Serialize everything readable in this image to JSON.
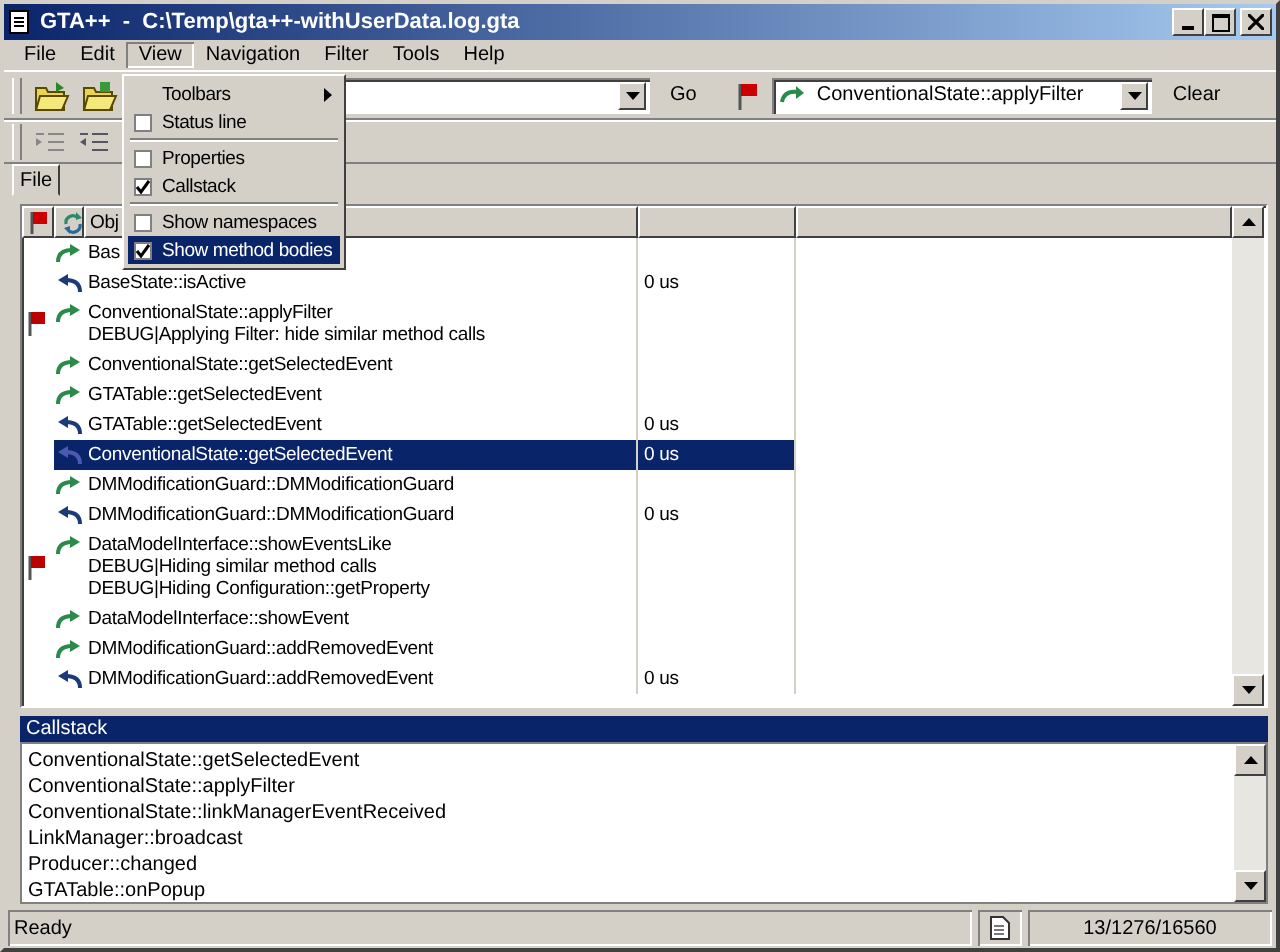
{
  "window": {
    "title": "GTA++  -  C:\\Temp\\gta++-withUserData.log.gta"
  },
  "menu_bar": [
    {
      "label": "File",
      "selected": false
    },
    {
      "label": "Edit",
      "selected": false
    },
    {
      "label": "View",
      "selected": true
    },
    {
      "label": "Navigation",
      "selected": false
    },
    {
      "label": "Filter",
      "selected": false
    },
    {
      "label": "Tools",
      "selected": false
    },
    {
      "label": "Help",
      "selected": false
    }
  ],
  "view_menu": [
    {
      "kind": "submenu",
      "label": "Toolbars",
      "selected": false
    },
    {
      "kind": "check",
      "label": "Status line",
      "checked": false,
      "selected": false
    },
    {
      "kind": "separator"
    },
    {
      "kind": "check",
      "label": "Properties",
      "checked": false,
      "selected": false
    },
    {
      "kind": "check",
      "label": "Callstack",
      "checked": true,
      "selected": false
    },
    {
      "kind": "separator"
    },
    {
      "kind": "check",
      "label": "Show namespaces",
      "checked": false,
      "selected": false
    },
    {
      "kind": "check",
      "label": "Show method bodies",
      "checked": true,
      "selected": true
    }
  ],
  "toolbar": {
    "go_button": "Go",
    "filter_combo": {
      "value": "ConventionalState::applyFilter"
    },
    "clear_button": "Clear"
  },
  "tabs": [
    {
      "label": "File",
      "selected": true
    }
  ],
  "table": {
    "object_column": "Obj",
    "rows": [
      {
        "kind": "call",
        "flagged": false,
        "lines": [
          "Bas"
        ],
        "time": "",
        "selected": false
      },
      {
        "kind": "return",
        "flagged": false,
        "lines": [
          "BaseState::isActive"
        ],
        "time": "0 us",
        "selected": false
      },
      {
        "kind": "call",
        "flagged": true,
        "lines": [
          "ConventionalState::applyFilter",
          "DEBUG|Applying Filter: hide similar method calls"
        ],
        "time": "",
        "selected": false
      },
      {
        "kind": "call",
        "flagged": false,
        "lines": [
          "ConventionalState::getSelectedEvent"
        ],
        "time": "",
        "selected": false
      },
      {
        "kind": "call",
        "flagged": false,
        "lines": [
          "GTATable::getSelectedEvent"
        ],
        "time": "",
        "selected": false
      },
      {
        "kind": "return",
        "flagged": false,
        "lines": [
          "GTATable::getSelectedEvent"
        ],
        "time": "0 us",
        "selected": false
      },
      {
        "kind": "return",
        "flagged": false,
        "lines": [
          "ConventionalState::getSelectedEvent"
        ],
        "time": "0 us",
        "selected": true
      },
      {
        "kind": "call",
        "flagged": false,
        "lines": [
          "DMModificationGuard::DMModificationGuard"
        ],
        "time": "",
        "selected": false
      },
      {
        "kind": "return",
        "flagged": false,
        "lines": [
          "DMModificationGuard::DMModificationGuard"
        ],
        "time": "0 us",
        "selected": false
      },
      {
        "kind": "call",
        "flagged": true,
        "lines": [
          "DataModelInterface::showEventsLike",
          "DEBUG|Hiding similar method calls",
          "DEBUG|Hiding Configuration::getProperty"
        ],
        "time": "",
        "selected": false
      },
      {
        "kind": "call",
        "flagged": false,
        "lines": [
          "DataModelInterface::showEvent"
        ],
        "time": "",
        "selected": false
      },
      {
        "kind": "call",
        "flagged": false,
        "lines": [
          "DMModificationGuard::addRemovedEvent"
        ],
        "time": "",
        "selected": false
      },
      {
        "kind": "return",
        "flagged": false,
        "lines": [
          "DMModificationGuard::addRemovedEvent"
        ],
        "time": "0 us",
        "selected": false
      }
    ]
  },
  "callstack": {
    "title": "Callstack",
    "items": [
      "ConventionalState::getSelectedEvent",
      "ConventionalState::applyFilter",
      "ConventionalState::linkManagerEventReceived",
      "LinkManager::broadcast",
      "Producer::changed",
      "GTATable::onPopup"
    ]
  },
  "status_bar": {
    "message": "Ready",
    "counts": "13/1276/16560"
  }
}
